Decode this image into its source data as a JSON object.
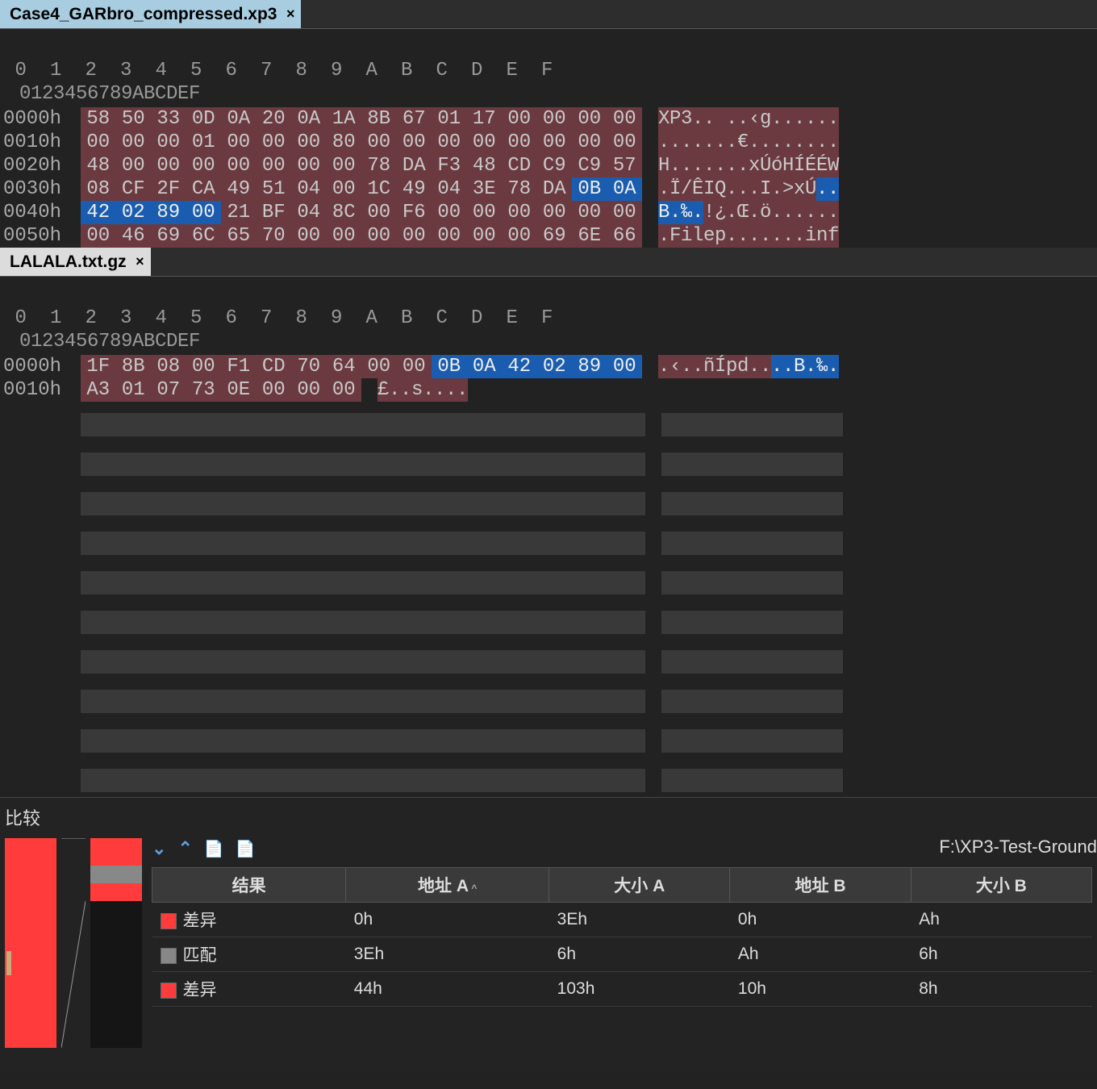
{
  "pane1": {
    "tab": "Case4_GARbro_compressed.xp3",
    "header": "0   1   2   3   4   5   6   7   8   9   A   B   C   D   E   F",
    "asciiHeader": "0123456789ABCDEF",
    "rows": [
      {
        "addr": "0000h",
        "hex": [
          "58",
          "50",
          "33",
          "0D",
          "0A",
          "20",
          "0A",
          "1A",
          "8B",
          "67",
          "01",
          "17",
          "00",
          "00",
          "00",
          "00"
        ],
        "cls": [
          "d",
          "d",
          "d",
          "d",
          "d",
          "d",
          "d",
          "d",
          "d",
          "d",
          "d",
          "d",
          "d",
          "d",
          "d",
          "d"
        ],
        "asc": [
          "X",
          "P",
          "3",
          ".",
          ".",
          " ",
          ".",
          ".",
          "‹",
          "g",
          ".",
          ".",
          ".",
          ".",
          ".",
          "."
        ],
        "acl": [
          "d",
          "d",
          "d",
          "d",
          "d",
          "d",
          "d",
          "d",
          "d",
          "d",
          "d",
          "d",
          "d",
          "d",
          "d",
          "d"
        ]
      },
      {
        "addr": "0010h",
        "hex": [
          "00",
          "00",
          "00",
          "01",
          "00",
          "00",
          "00",
          "80",
          "00",
          "00",
          "00",
          "00",
          "00",
          "00",
          "00",
          "00"
        ],
        "cls": [
          "d",
          "d",
          "d",
          "d",
          "d",
          "d",
          "d",
          "d",
          "d",
          "d",
          "d",
          "d",
          "d",
          "d",
          "d",
          "d"
        ],
        "asc": [
          ".",
          ".",
          ".",
          ".",
          ".",
          ".",
          ".",
          "€",
          ".",
          ".",
          ".",
          ".",
          ".",
          ".",
          ".",
          "."
        ],
        "acl": [
          "d",
          "d",
          "d",
          "d",
          "d",
          "d",
          "d",
          "d",
          "d",
          "d",
          "d",
          "d",
          "d",
          "d",
          "d",
          "d"
        ]
      },
      {
        "addr": "0020h",
        "hex": [
          "48",
          "00",
          "00",
          "00",
          "00",
          "00",
          "00",
          "00",
          "78",
          "DA",
          "F3",
          "48",
          "CD",
          "C9",
          "C9",
          "57"
        ],
        "cls": [
          "d",
          "d",
          "d",
          "d",
          "d",
          "d",
          "d",
          "d",
          "d",
          "d",
          "d",
          "d",
          "d",
          "d",
          "d",
          "d"
        ],
        "asc": [
          "H",
          ".",
          ".",
          ".",
          ".",
          ".",
          ".",
          ".",
          "x",
          "Ú",
          "ó",
          "H",
          "Í",
          "É",
          "É",
          "W"
        ],
        "acl": [
          "d",
          "d",
          "d",
          "d",
          "d",
          "d",
          "d",
          "d",
          "d",
          "d",
          "d",
          "d",
          "d",
          "d",
          "d",
          "d"
        ]
      },
      {
        "addr": "0030h",
        "hex": [
          "08",
          "CF",
          "2F",
          "CA",
          "49",
          "51",
          "04",
          "00",
          "1C",
          "49",
          "04",
          "3E",
          "78",
          "DA",
          "0B",
          "0A"
        ],
        "cls": [
          "d",
          "d",
          "d",
          "d",
          "d",
          "d",
          "d",
          "d",
          "d",
          "d",
          "d",
          "d",
          "d",
          "d",
          "s",
          "s"
        ],
        "asc": [
          ".",
          "Ï",
          "/",
          "Ê",
          "I",
          "Q",
          ".",
          ".",
          ".",
          "I",
          ".",
          ">",
          "x",
          "Ú",
          ".",
          "."
        ],
        "acl": [
          "d",
          "d",
          "d",
          "d",
          "d",
          "d",
          "d",
          "d",
          "d",
          "d",
          "d",
          "d",
          "d",
          "d",
          "s",
          "s"
        ]
      },
      {
        "addr": "0040h",
        "hex": [
          "42",
          "02",
          "89",
          "00",
          "21",
          "BF",
          "04",
          "8C",
          "00",
          "F6",
          "00",
          "00",
          "00",
          "00",
          "00",
          "00"
        ],
        "cls": [
          "s",
          "s",
          "s",
          "s",
          "d",
          "d",
          "d",
          "d",
          "d",
          "d",
          "d",
          "d",
          "d",
          "d",
          "d",
          "d"
        ],
        "asc": [
          "B",
          ".",
          "‰",
          ".",
          "!",
          "¿",
          ".",
          "Œ",
          ".",
          "ö",
          ".",
          ".",
          ".",
          ".",
          ".",
          "."
        ],
        "acl": [
          "s",
          "s",
          "s",
          "s",
          "d",
          "d",
          "d",
          "d",
          "d",
          "d",
          "d",
          "d",
          "d",
          "d",
          "d",
          "d"
        ]
      },
      {
        "addr": "0050h",
        "hex": [
          "00",
          "46",
          "69",
          "6C",
          "65",
          "70",
          "00",
          "00",
          "00",
          "00",
          "00",
          "00",
          "00",
          "69",
          "6E",
          "66"
        ],
        "cls": [
          "d",
          "d",
          "d",
          "d",
          "d",
          "d",
          "d",
          "d",
          "d",
          "d",
          "d",
          "d",
          "d",
          "d",
          "d",
          "d"
        ],
        "asc": [
          ".",
          "F",
          "i",
          "l",
          "e",
          "p",
          ".",
          ".",
          ".",
          ".",
          ".",
          ".",
          ".",
          "i",
          "n",
          "f"
        ],
        "acl": [
          "d",
          "d",
          "d",
          "d",
          "d",
          "d",
          "d",
          "d",
          "d",
          "d",
          "d",
          "d",
          "d",
          "d",
          "d",
          "d"
        ]
      }
    ]
  },
  "pane2": {
    "tab": "LALALA.txt.gz",
    "header": "0   1   2   3   4   5   6   7   8   9   A   B   C   D   E   F",
    "asciiHeader": "0123456789ABCDEF",
    "rows": [
      {
        "addr": "0000h",
        "hex": [
          "1F",
          "8B",
          "08",
          "00",
          "F1",
          "CD",
          "70",
          "64",
          "00",
          "00",
          "0B",
          "0A",
          "42",
          "02",
          "89",
          "00"
        ],
        "cls": [
          "d",
          "d",
          "d",
          "d",
          "d",
          "d",
          "d",
          "d",
          "d",
          "d",
          "s",
          "s",
          "s",
          "s",
          "s",
          "s"
        ],
        "asc": [
          ".",
          "‹",
          ".",
          ".",
          "ñ",
          "Í",
          "p",
          "d",
          ".",
          ".",
          ".",
          ".",
          "B",
          ".",
          "‰",
          "."
        ],
        "acl": [
          "d",
          "d",
          "d",
          "d",
          "d",
          "d",
          "d",
          "d",
          "d",
          "d",
          "s",
          "s",
          "s",
          "s",
          "s",
          "s"
        ]
      },
      {
        "addr": "0010h",
        "hex": [
          "A3",
          "01",
          "07",
          "73",
          "0E",
          "00",
          "00",
          "00"
        ],
        "cls": [
          "d",
          "d",
          "d",
          "d",
          "d",
          "d",
          "d",
          "d"
        ],
        "asc": [
          "£",
          ".",
          ".",
          "s",
          ".",
          ".",
          ".",
          "."
        ],
        "acl": [
          "d",
          "d",
          "d",
          "d",
          "d",
          "d",
          "d",
          "d"
        ]
      }
    ],
    "emptyRows": 10
  },
  "compare": {
    "title": "比较",
    "path": "F:\\XP3-Test-Ground",
    "columns": [
      "结果",
      "地址 A",
      "大小 A",
      "地址 B",
      "大小 B"
    ],
    "sortedCol": 1,
    "rows": [
      {
        "swatch": "red",
        "label": "差异",
        "addrA": "0h",
        "sizeA": "3Eh",
        "addrB": "0h",
        "sizeB": "Ah"
      },
      {
        "swatch": "gray",
        "label": "匹配",
        "addrA": "3Eh",
        "sizeA": "6h",
        "addrB": "Ah",
        "sizeB": "6h"
      },
      {
        "swatch": "red",
        "label": "差异",
        "addrA": "44h",
        "sizeA": "103h",
        "addrB": "10h",
        "sizeB": "8h"
      }
    ]
  }
}
